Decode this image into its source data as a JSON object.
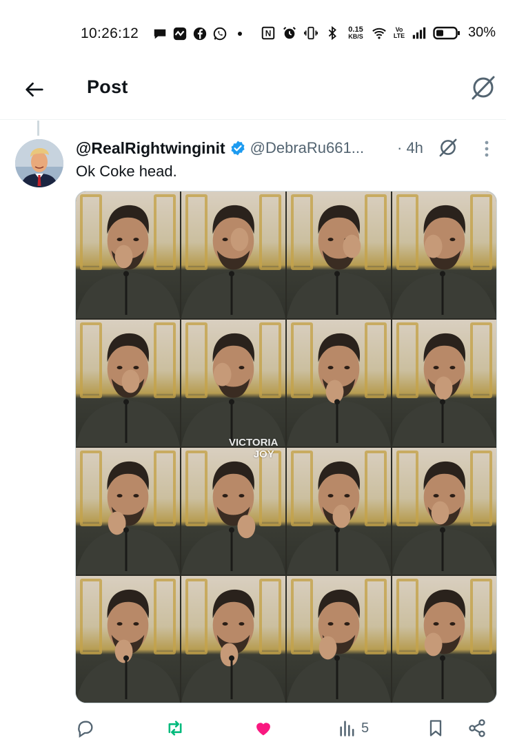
{
  "status_bar": {
    "time": "10:26:12",
    "data_speed_value": "0.15",
    "data_speed_unit": "KB/S",
    "volte_top": "Vo",
    "volte_bottom": "LTE",
    "nfc_label": "N",
    "battery": "30%",
    "icons": [
      "chat-icon",
      "activity-icon",
      "facebook-icon",
      "whatsapp-icon",
      "nfc-icon",
      "alarm-icon",
      "vibrate-icon",
      "bluetooth-icon",
      "wifi-icon",
      "signal-icon",
      "battery-icon"
    ]
  },
  "header": {
    "title": "Post",
    "icons": [
      "back-arrow-icon",
      "grok-icon"
    ]
  },
  "tweet": {
    "display_name": "@RealRightwinginit",
    "handle": "@DebraRu661...",
    "timestamp": "· 4h",
    "text": "Ok Coke head.",
    "verified_color": "#1d9bf0",
    "media": {
      "rows": 4,
      "columns": 4,
      "watermark_line1": "VICTORIA",
      "watermark_line2": "JOY"
    }
  },
  "actions": {
    "reply_count": "",
    "repost_count": "",
    "like_count": "",
    "views_count": "5",
    "icons": [
      "reply-icon",
      "repost-icon",
      "like-icon",
      "views-icon",
      "bookmark-icon",
      "share-icon"
    ],
    "colors": {
      "repost": "#00ba7c",
      "like": "#f91880",
      "muted": "#536471"
    }
  }
}
